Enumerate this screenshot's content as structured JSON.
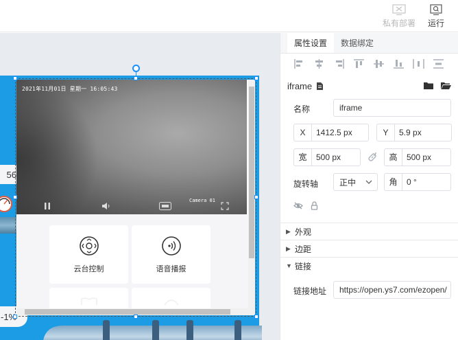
{
  "toolbar": {
    "private_deploy_label": "私有部署",
    "run_label": "运行"
  },
  "canvas": {
    "left_value": "56",
    "left_percent": "-1%"
  },
  "video": {
    "timestamp": "2021年11月01日 星期一 16:05:43",
    "camera_label": "Camera 01"
  },
  "controls": {
    "ptz_label": "云台控制",
    "voice_label": "语音播报"
  },
  "panel": {
    "tabs": [
      "属性设置",
      "数据绑定"
    ],
    "component_name": "iframe",
    "name_label": "名称",
    "name_value": "iframe",
    "x_label": "X",
    "x_value": "1412.5 px",
    "y_label": "Y",
    "y_value": "5.9 px",
    "width_label": "宽",
    "width_value": "500 px",
    "height_label": "高",
    "height_value": "500 px",
    "pivot_label": "旋转轴",
    "pivot_value": "正中",
    "angle_label": "角",
    "angle_value": "0 °",
    "sections": [
      "外观",
      "边距",
      "链接"
    ],
    "link_label": "链接地址",
    "link_value": "https://open.ys7.com/ezopen/"
  },
  "colors": {
    "accent": "#1890ff",
    "canvas_blue": "#1d9ce6"
  }
}
